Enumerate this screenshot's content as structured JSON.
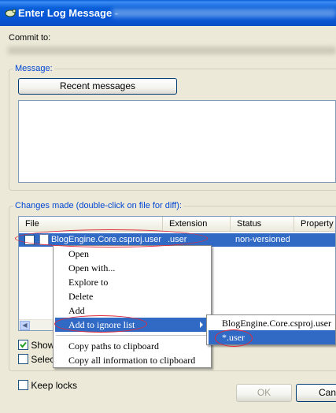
{
  "window": {
    "title": "Enter Log Message -",
    "title_icon": "tortoise-icon"
  },
  "commit_label": "Commit to:",
  "message_group": {
    "legend": "Message:",
    "recent_messages_button": "Recent messages",
    "message_text": ""
  },
  "changes_group": {
    "legend": "Changes made (double-click on file for diff):",
    "columns": [
      "File",
      "Extension",
      "Status",
      "Property"
    ],
    "rows": [
      {
        "file": "BlogEngine.Core.csproj.user",
        "extension": ".user",
        "status": "non-versioned",
        "checked": false,
        "selected": true
      }
    ]
  },
  "options": {
    "show_label": "Show",
    "select_label": "Select",
    "show_checked": true,
    "select_checked": false
  },
  "context_menu": {
    "items": [
      "Open",
      "Open with...",
      "Explore to",
      "Delete",
      "Add",
      "Add to ignore list",
      "Copy paths to clipboard",
      "Copy all information to clipboard"
    ],
    "selected": "Add to ignore list"
  },
  "submenu": {
    "items": [
      "BlogEngine.Core.csproj.user",
      "*.user"
    ],
    "selected": "*.user"
  },
  "keep_locks_label": "Keep locks",
  "buttons": {
    "ok": "OK",
    "cancel": "Can"
  },
  "colors": {
    "selection": "#316ac5",
    "legend_text": "#0046d5",
    "annotation": "#e0283a",
    "title_bar": "#0a5fd8"
  }
}
